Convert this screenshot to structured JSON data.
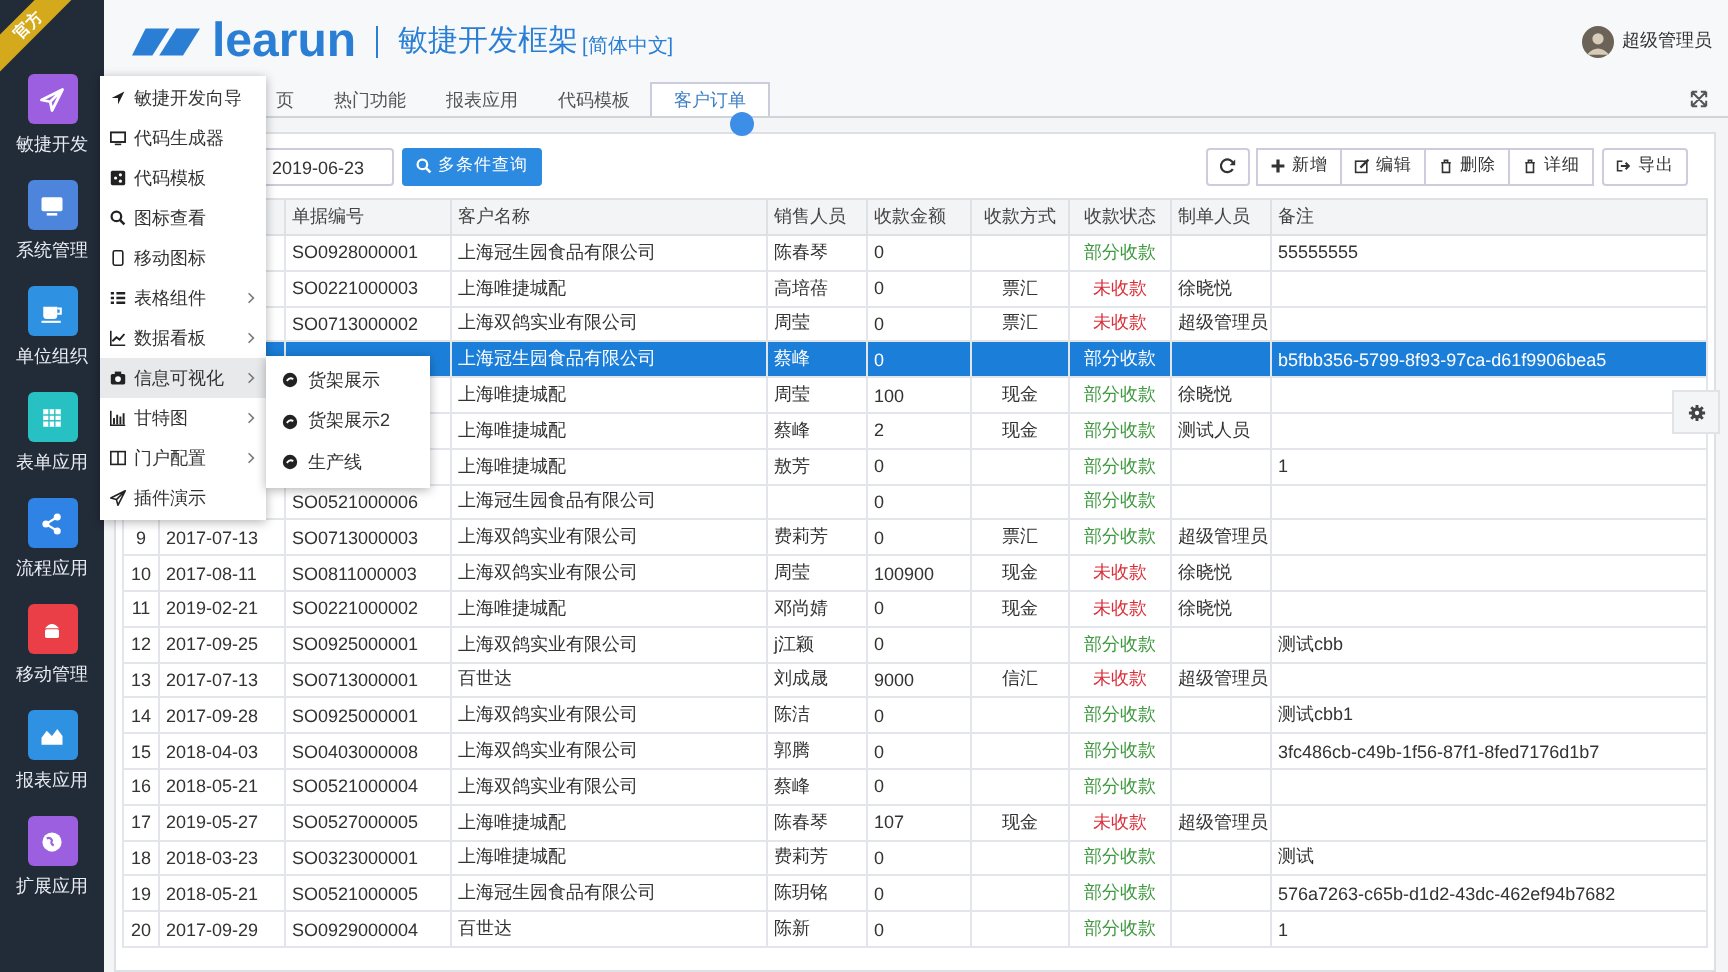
{
  "sidebar": {
    "badge": "官方",
    "items": [
      {
        "label": "敏捷开发",
        "color": "#9b5fe0"
      },
      {
        "label": "系统管理",
        "color": "#4d84dc"
      },
      {
        "label": "单位组织",
        "color": "#2f91e2"
      },
      {
        "label": "表单应用",
        "color": "#27c1c4"
      },
      {
        "label": "流程应用",
        "color": "#2f83e4"
      },
      {
        "label": "移动管理",
        "color": "#ea3f47"
      },
      {
        "label": "报表应用",
        "color": "#2f91e2"
      },
      {
        "label": "扩展应用",
        "color": "#9b5fe0"
      }
    ]
  },
  "header": {
    "logo": "learun",
    "title": "敏捷开发框架",
    "language": "[简体中文]",
    "user": "超级管理员"
  },
  "tabs": [
    {
      "label": "页",
      "selected": false
    },
    {
      "label": "热门功能",
      "selected": false
    },
    {
      "label": "报表应用",
      "selected": false
    },
    {
      "label": "代码模板",
      "selected": false
    },
    {
      "label": "客户订单",
      "selected": true
    }
  ],
  "toolbar": {
    "date": "2019-06-23",
    "search_button": "多条件查询",
    "buttons": [
      "新增",
      "编辑",
      "删除",
      "详细"
    ],
    "export_button": "导出"
  },
  "table": {
    "columns": [
      "单据编号",
      "客户名称",
      "销售人员",
      "收款金额",
      "收款方式",
      "收款状态",
      "制单人员",
      "备注"
    ],
    "rows": [
      {
        "order": "SO0928000001",
        "customer": "上海冠生园食品有限公司",
        "sales": "陈春琴",
        "amount": "0",
        "status": "部分收款",
        "color": "#3f9a3f",
        "note": "55555555",
        "selected": false
      },
      {
        "order": "SO0221000003",
        "customer": "上海唯捷城配",
        "sales": "高培蓓",
        "amount": "0",
        "method": "票汇",
        "status": "未收款",
        "color": "#d9303a",
        "maker": "徐晓悦",
        "selected": false
      },
      {
        "order": "SO0713000002",
        "customer": "上海双鸽实业有限公司",
        "sales": "周莹",
        "amount": "0",
        "method": "票汇",
        "status": "未收款",
        "color": "#d9303a",
        "maker": "超级管理员",
        "selected": false
      },
      {
        "customer": "上海冠生园食品有限公司",
        "sales": "蔡峰",
        "amount": "0",
        "status": "部分收款",
        "note": "b5fbb356-5799-8f93-97ca-d61f9906bea5",
        "selected": true
      },
      {
        "customer": "上海唯捷城配",
        "sales": "周莹",
        "amount": "100",
        "method": "现金",
        "status": "部分收款",
        "color": "#3f9a3f",
        "maker": "徐晓悦",
        "selected": false
      },
      {
        "customer": "上海唯捷城配",
        "sales": "蔡峰",
        "amount": "2",
        "method": "现金",
        "status": "部分收款",
        "color": "#3f9a3f",
        "maker": "测试人员",
        "selected": false
      },
      {
        "customer": "上海唯捷城配",
        "sales": "敖芳",
        "amount": "0",
        "status": "部分收款",
        "color": "#3f9a3f",
        "note": "1",
        "selected": false
      },
      {
        "order": "SO0521000006",
        "customer": "上海冠生园食品有限公司",
        "amount": "0",
        "status": "部分收款",
        "color": "#3f9a3f",
        "selected": false
      },
      {
        "no": "9",
        "date": "2017-07-13",
        "order": "SO0713000003",
        "customer": "上海双鸽实业有限公司",
        "sales": "费莉芳",
        "amount": "0",
        "method": "票汇",
        "status": "部分收款",
        "color": "#3f9a3f",
        "maker": "超级管理员",
        "selected": false
      },
      {
        "no": "10",
        "date": "2017-08-11",
        "order": "SO0811000003",
        "customer": "上海双鸽实业有限公司",
        "sales": "周莹",
        "amount": "100900",
        "method": "现金",
        "status": "未收款",
        "color": "#d9303a",
        "maker": "徐晓悦",
        "selected": false
      },
      {
        "no": "11",
        "date": "2019-02-21",
        "order": "SO0221000002",
        "customer": "上海唯捷城配",
        "sales": "邓尚婧",
        "amount": "0",
        "method": "现金",
        "status": "未收款",
        "color": "#d9303a",
        "maker": "徐晓悦",
        "selected": false
      },
      {
        "no": "12",
        "date": "2017-09-25",
        "order": "SO0925000001",
        "customer": "上海双鸽实业有限公司",
        "sales": "j江颖",
        "amount": "0",
        "status": "部分收款",
        "color": "#3f9a3f",
        "note": "测试cbb",
        "selected": false
      },
      {
        "no": "13",
        "date": "2017-07-13",
        "order": "SO0713000001",
        "customer": "百世达",
        "sales": "刘成晟",
        "amount": "9000",
        "method": "信汇",
        "status": "未收款",
        "color": "#d9303a",
        "maker": "超级管理员",
        "selected": false
      },
      {
        "no": "14",
        "date": "2017-09-28",
        "order": "SO0925000001",
        "customer": "上海双鸽实业有限公司",
        "sales": "陈洁",
        "amount": "0",
        "status": "部分收款",
        "color": "#3f9a3f",
        "note": "测试cbb1",
        "selected": false
      },
      {
        "no": "15",
        "date": "2018-04-03",
        "order": "SO0403000008",
        "customer": "上海双鸽实业有限公司",
        "sales": "郭腾",
        "amount": "0",
        "status": "部分收款",
        "color": "#3f9a3f",
        "note": "3fc486cb-c49b-1f56-87f1-8fed7176d1b7",
        "selected": false
      },
      {
        "no": "16",
        "date": "2018-05-21",
        "order": "SO0521000004",
        "customer": "上海双鸽实业有限公司",
        "sales": "蔡峰",
        "amount": "0",
        "status": "部分收款",
        "color": "#3f9a3f",
        "selected": false
      },
      {
        "no": "17",
        "date": "2019-05-27",
        "order": "SO0527000005",
        "customer": "上海唯捷城配",
        "sales": "陈春琴",
        "amount": "107",
        "method": "现金",
        "status": "未收款",
        "color": "#d9303a",
        "maker": "超级管理员",
        "selected": false
      },
      {
        "no": "18",
        "date": "2018-03-23",
        "order": "SO0323000001",
        "customer": "上海唯捷城配",
        "sales": "费莉芳",
        "amount": "0",
        "status": "部分收款",
        "color": "#3f9a3f",
        "note": "测试",
        "selected": false
      },
      {
        "no": "19",
        "date": "2018-05-21",
        "order": "SO0521000005",
        "customer": "上海冠生园食品有限公司",
        "sales": "陈玥铭",
        "amount": "0",
        "status": "部分收款",
        "color": "#3f9a3f",
        "note": "576a7263-c65b-d1d2-43dc-462ef94b7682",
        "selected": false
      },
      {
        "no": "20",
        "date": "2017-09-29",
        "order": "SO0929000004",
        "customer": "百世达",
        "sales": "陈新",
        "amount": "0",
        "status": "部分收款",
        "color": "#3f9a3f",
        "note": "1",
        "selected": false
      }
    ]
  },
  "menu": {
    "items": [
      {
        "label": "敏捷开发向导",
        "has_submenu": false,
        "selected": false
      },
      {
        "label": "代码生成器",
        "has_submenu": false,
        "selected": false
      },
      {
        "label": "代码模板",
        "has_submenu": false,
        "selected": false
      },
      {
        "label": "图标查看",
        "has_submenu": false,
        "selected": false
      },
      {
        "label": "移动图标",
        "has_submenu": false,
        "selected": false
      },
      {
        "label": "表格组件",
        "has_submenu": true,
        "selected": false
      },
      {
        "label": "数据看板",
        "has_submenu": true,
        "selected": false
      },
      {
        "label": "信息可视化",
        "has_submenu": true,
        "selected": true
      },
      {
        "label": "甘特图",
        "has_submenu": true,
        "selected": false
      },
      {
        "label": "门户配置",
        "has_submenu": true,
        "selected": false
      },
      {
        "label": "插件演示",
        "has_submenu": false,
        "selected": false
      }
    ],
    "submenu": [
      "货架展示",
      "货架展示2",
      "生产线"
    ]
  }
}
